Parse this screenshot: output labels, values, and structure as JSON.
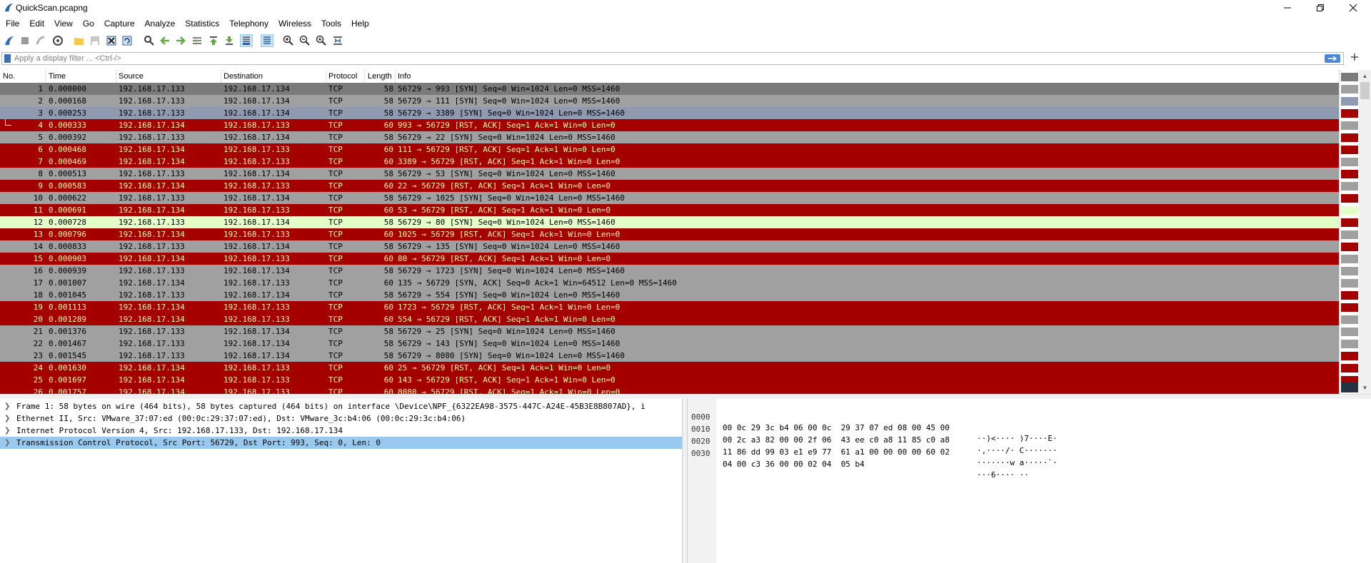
{
  "window": {
    "title": "QuickScan.pcapng"
  },
  "menu": [
    "File",
    "Edit",
    "View",
    "Go",
    "Capture",
    "Analyze",
    "Statistics",
    "Telephony",
    "Wireless",
    "Tools",
    "Help"
  ],
  "filter": {
    "placeholder": "Apply a display filter ... <Ctrl-/>",
    "value": ""
  },
  "columns": [
    "No.",
    "Time",
    "Source",
    "Destination",
    "Protocol",
    "Length",
    "Info"
  ],
  "colors": {
    "red_row": "#a40000",
    "red_text": "#fffc9c",
    "gray_row": "#a0a0a0",
    "gray_selected": "#7b7b7b",
    "blue_row": "#8f9ab0",
    "green_row": "#e4ffc7",
    "selection": "#99c9ef"
  },
  "packets": [
    {
      "no": "1",
      "time": "0.000000",
      "src": "192.168.17.133",
      "dst": "192.168.17.134",
      "proto": "TCP",
      "len": "58",
      "info": "56729 → 993 [SYN] Seq=0 Win=1024 Len=0 MSS=1460",
      "style": "sel"
    },
    {
      "no": "2",
      "time": "0.000168",
      "src": "192.168.17.133",
      "dst": "192.168.17.134",
      "proto": "TCP",
      "len": "58",
      "info": "56729 → 111 [SYN] Seq=0 Win=1024 Len=0 MSS=1460",
      "style": "gray"
    },
    {
      "no": "3",
      "time": "0.000253",
      "src": "192.168.17.133",
      "dst": "192.168.17.134",
      "proto": "TCP",
      "len": "58",
      "info": "56729 → 3389 [SYN] Seq=0 Win=1024 Len=0 MSS=1460",
      "style": "blue"
    },
    {
      "no": "4",
      "time": "0.000333",
      "src": "192.168.17.134",
      "dst": "192.168.17.133",
      "proto": "TCP",
      "len": "60",
      "info": "993 → 56729 [RST, ACK] Seq=1 Ack=1 Win=0 Len=0",
      "style": "red",
      "related": true
    },
    {
      "no": "5",
      "time": "0.000392",
      "src": "192.168.17.133",
      "dst": "192.168.17.134",
      "proto": "TCP",
      "len": "58",
      "info": "56729 → 22 [SYN] Seq=0 Win=1024 Len=0 MSS=1460",
      "style": "gray"
    },
    {
      "no": "6",
      "time": "0.000468",
      "src": "192.168.17.134",
      "dst": "192.168.17.133",
      "proto": "TCP",
      "len": "60",
      "info": "111 → 56729 [RST, ACK] Seq=1 Ack=1 Win=0 Len=0",
      "style": "red"
    },
    {
      "no": "7",
      "time": "0.000469",
      "src": "192.168.17.134",
      "dst": "192.168.17.133",
      "proto": "TCP",
      "len": "60",
      "info": "3389 → 56729 [RST, ACK] Seq=1 Ack=1 Win=0 Len=0",
      "style": "red"
    },
    {
      "no": "8",
      "time": "0.000513",
      "src": "192.168.17.133",
      "dst": "192.168.17.134",
      "proto": "TCP",
      "len": "58",
      "info": "56729 → 53 [SYN] Seq=0 Win=1024 Len=0 MSS=1460",
      "style": "gray"
    },
    {
      "no": "9",
      "time": "0.000583",
      "src": "192.168.17.134",
      "dst": "192.168.17.133",
      "proto": "TCP",
      "len": "60",
      "info": "22 → 56729 [RST, ACK] Seq=1 Ack=1 Win=0 Len=0",
      "style": "red"
    },
    {
      "no": "10",
      "time": "0.000622",
      "src": "192.168.17.133",
      "dst": "192.168.17.134",
      "proto": "TCP",
      "len": "58",
      "info": "56729 → 1025 [SYN] Seq=0 Win=1024 Len=0 MSS=1460",
      "style": "gray"
    },
    {
      "no": "11",
      "time": "0.000691",
      "src": "192.168.17.134",
      "dst": "192.168.17.133",
      "proto": "TCP",
      "len": "60",
      "info": "53 → 56729 [RST, ACK] Seq=1 Ack=1 Win=0 Len=0",
      "style": "red"
    },
    {
      "no": "12",
      "time": "0.000728",
      "src": "192.168.17.133",
      "dst": "192.168.17.134",
      "proto": "TCP",
      "len": "58",
      "info": "56729 → 80 [SYN] Seq=0 Win=1024 Len=0 MSS=1460",
      "style": "green"
    },
    {
      "no": "13",
      "time": "0.000796",
      "src": "192.168.17.134",
      "dst": "192.168.17.133",
      "proto": "TCP",
      "len": "60",
      "info": "1025 → 56729 [RST, ACK] Seq=1 Ack=1 Win=0 Len=0",
      "style": "red"
    },
    {
      "no": "14",
      "time": "0.000833",
      "src": "192.168.17.133",
      "dst": "192.168.17.134",
      "proto": "TCP",
      "len": "58",
      "info": "56729 → 135 [SYN] Seq=0 Win=1024 Len=0 MSS=1460",
      "style": "gray"
    },
    {
      "no": "15",
      "time": "0.000903",
      "src": "192.168.17.134",
      "dst": "192.168.17.133",
      "proto": "TCP",
      "len": "60",
      "info": "80 → 56729 [RST, ACK] Seq=1 Ack=1 Win=0 Len=0",
      "style": "red"
    },
    {
      "no": "16",
      "time": "0.000939",
      "src": "192.168.17.133",
      "dst": "192.168.17.134",
      "proto": "TCP",
      "len": "58",
      "info": "56729 → 1723 [SYN] Seq=0 Win=1024 Len=0 MSS=1460",
      "style": "gray"
    },
    {
      "no": "17",
      "time": "0.001007",
      "src": "192.168.17.134",
      "dst": "192.168.17.133",
      "proto": "TCP",
      "len": "60",
      "info": "135 → 56729 [SYN, ACK] Seq=0 Ack=1 Win=64512 Len=0 MSS=1460",
      "style": "gray"
    },
    {
      "no": "18",
      "time": "0.001045",
      "src": "192.168.17.133",
      "dst": "192.168.17.134",
      "proto": "TCP",
      "len": "58",
      "info": "56729 → 554 [SYN] Seq=0 Win=1024 Len=0 MSS=1460",
      "style": "gray"
    },
    {
      "no": "19",
      "time": "0.001113",
      "src": "192.168.17.134",
      "dst": "192.168.17.133",
      "proto": "TCP",
      "len": "60",
      "info": "1723 → 56729 [RST, ACK] Seq=1 Ack=1 Win=0 Len=0",
      "style": "red"
    },
    {
      "no": "20",
      "time": "0.001289",
      "src": "192.168.17.134",
      "dst": "192.168.17.133",
      "proto": "TCP",
      "len": "60",
      "info": "554 → 56729 [RST, ACK] Seq=1 Ack=1 Win=0 Len=0",
      "style": "red"
    },
    {
      "no": "21",
      "time": "0.001376",
      "src": "192.168.17.133",
      "dst": "192.168.17.134",
      "proto": "TCP",
      "len": "58",
      "info": "56729 → 25 [SYN] Seq=0 Win=1024 Len=0 MSS=1460",
      "style": "gray"
    },
    {
      "no": "22",
      "time": "0.001467",
      "src": "192.168.17.133",
      "dst": "192.168.17.134",
      "proto": "TCP",
      "len": "58",
      "info": "56729 → 143 [SYN] Seq=0 Win=1024 Len=0 MSS=1460",
      "style": "gray"
    },
    {
      "no": "23",
      "time": "0.001545",
      "src": "192.168.17.133",
      "dst": "192.168.17.134",
      "proto": "TCP",
      "len": "58",
      "info": "56729 → 8080 [SYN] Seq=0 Win=1024 Len=0 MSS=1460",
      "style": "gray"
    },
    {
      "no": "24",
      "time": "0.001630",
      "src": "192.168.17.134",
      "dst": "192.168.17.133",
      "proto": "TCP",
      "len": "60",
      "info": "25 → 56729 [RST, ACK] Seq=1 Ack=1 Win=0 Len=0",
      "style": "red"
    },
    {
      "no": "25",
      "time": "0.001697",
      "src": "192.168.17.134",
      "dst": "192.168.17.133",
      "proto": "TCP",
      "len": "60",
      "info": "143 → 56729 [RST, ACK] Seq=1 Ack=1 Win=0 Len=0",
      "style": "red"
    },
    {
      "no": "26",
      "time": "0.001757",
      "src": "192.168.17.134",
      "dst": "192.168.17.133",
      "proto": "TCP",
      "len": "60",
      "info": "8080 → 56729 [RST, ACK] Seq=1 Ack=1 Win=0 Len=0",
      "style": "red"
    }
  ],
  "details": [
    {
      "text": "Frame 1: 58 bytes on wire (464 bits), 58 bytes captured (464 bits) on interface \\Device\\NPF_{6322EA98-3575-447C-A24E-45B3E8B807AD}, i",
      "selected": false
    },
    {
      "text": "Ethernet II, Src: VMware_37:07:ed (00:0c:29:37:07:ed), Dst: VMware_3c:b4:06 (00:0c:29:3c:b4:06)",
      "selected": false
    },
    {
      "text": "Internet Protocol Version 4, Src: 192.168.17.133, Dst: 192.168.17.134",
      "selected": false
    },
    {
      "text": "Transmission Control Protocol, Src Port: 56729, Dst Port: 993, Seq: 0, Len: 0",
      "selected": true
    }
  ],
  "bytes": [
    {
      "offset": "0000",
      "hex": "00 0c 29 3c b4 06 00 0c  29 37 07 ed 08 00 45 00",
      "ascii": "··)<···· )7····E·"
    },
    {
      "offset": "0010",
      "hex": "00 2c a3 82 00 00 2f 06  43 ee c0 a8 11 85 c0 a8",
      "ascii": "·,····/· C·······"
    },
    {
      "offset": "0020",
      "hex": "11 86 dd 99 03 e1 e9 77  61 a1 00 00 00 00 60 02",
      "ascii": "·······w a·····`·"
    },
    {
      "offset": "0030",
      "hex": "04 00 c3 36 00 00 02 04  05 b4",
      "ascii": "···6···· ··"
    }
  ]
}
